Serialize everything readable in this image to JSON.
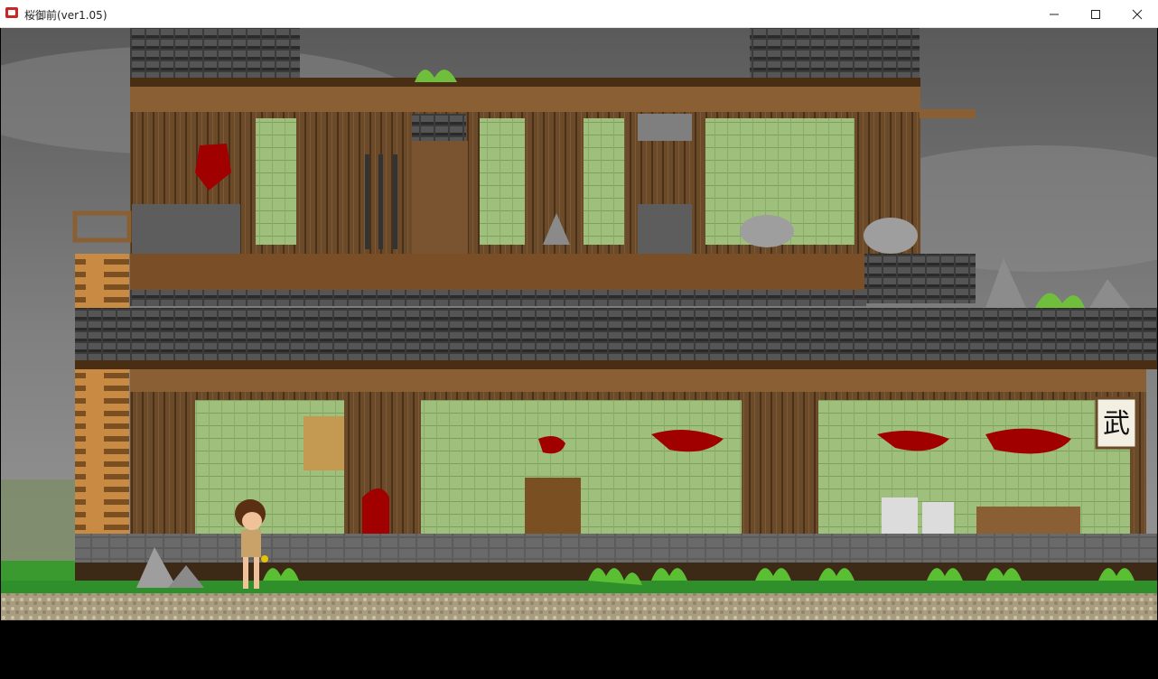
{
  "window": {
    "title": "桜御前(ver1.05)",
    "controls": {
      "minimize": "minimize",
      "maximize": "maximize",
      "close": "close"
    }
  },
  "icons": [
    "app-icon",
    "minimize-icon",
    "maximize-icon",
    "close-icon"
  ],
  "scene": {
    "description_free": true,
    "sign_glyph": "武"
  },
  "colors": {
    "sky": "#6f6f6f",
    "roof_tile": "#3a3a3a",
    "wood_dark": "#5a3a1e",
    "wood_light": "#b57a3c",
    "tatami_wall": "#9fc07c",
    "blood": "#a00000",
    "walkway": "#6b6b6b",
    "grass": "#2f8f2a",
    "gravel": "#b8ad8e"
  }
}
